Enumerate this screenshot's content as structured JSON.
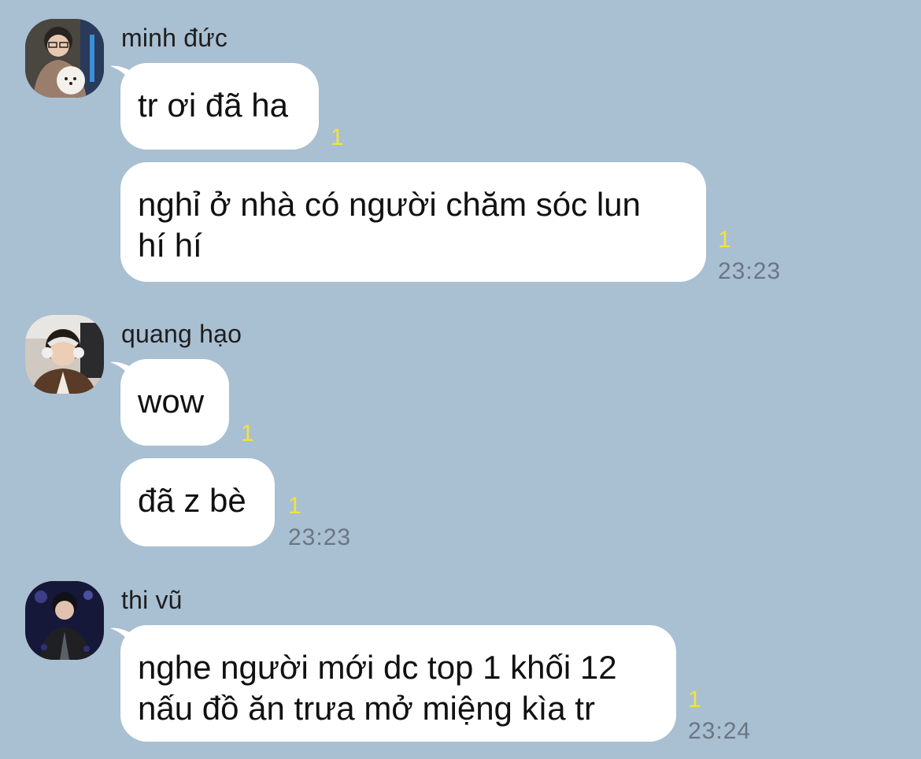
{
  "conversation": {
    "groups": [
      {
        "sender": "minh đức",
        "avatar_icon": "profile-photo-with-dog",
        "messages": [
          {
            "text": "tr ơi đã ha",
            "unread": "1"
          },
          {
            "text": "nghỉ ở nhà có người chăm sóc lun\nhí hí",
            "unread": "1",
            "time": "23:23"
          }
        ]
      },
      {
        "sender": "quang hạo",
        "avatar_icon": "profile-photo-headphones",
        "messages": [
          {
            "text": "wow",
            "unread": "1"
          },
          {
            "text": "đã z bè",
            "unread": "1",
            "time": "23:23"
          }
        ]
      },
      {
        "sender": "thi vũ",
        "avatar_icon": "profile-photo-stage",
        "messages": [
          {
            "text": "nghe người mới dc top 1 khối 12\nnấu đồ ăn trưa mở miệng kìa tr",
            "unread": "1",
            "time": "23:24"
          }
        ]
      }
    ]
  },
  "colors": {
    "background": "#a9bfd2",
    "bubble": "#ffffff",
    "unread": "#f2e33a",
    "time": "#6a7683"
  }
}
